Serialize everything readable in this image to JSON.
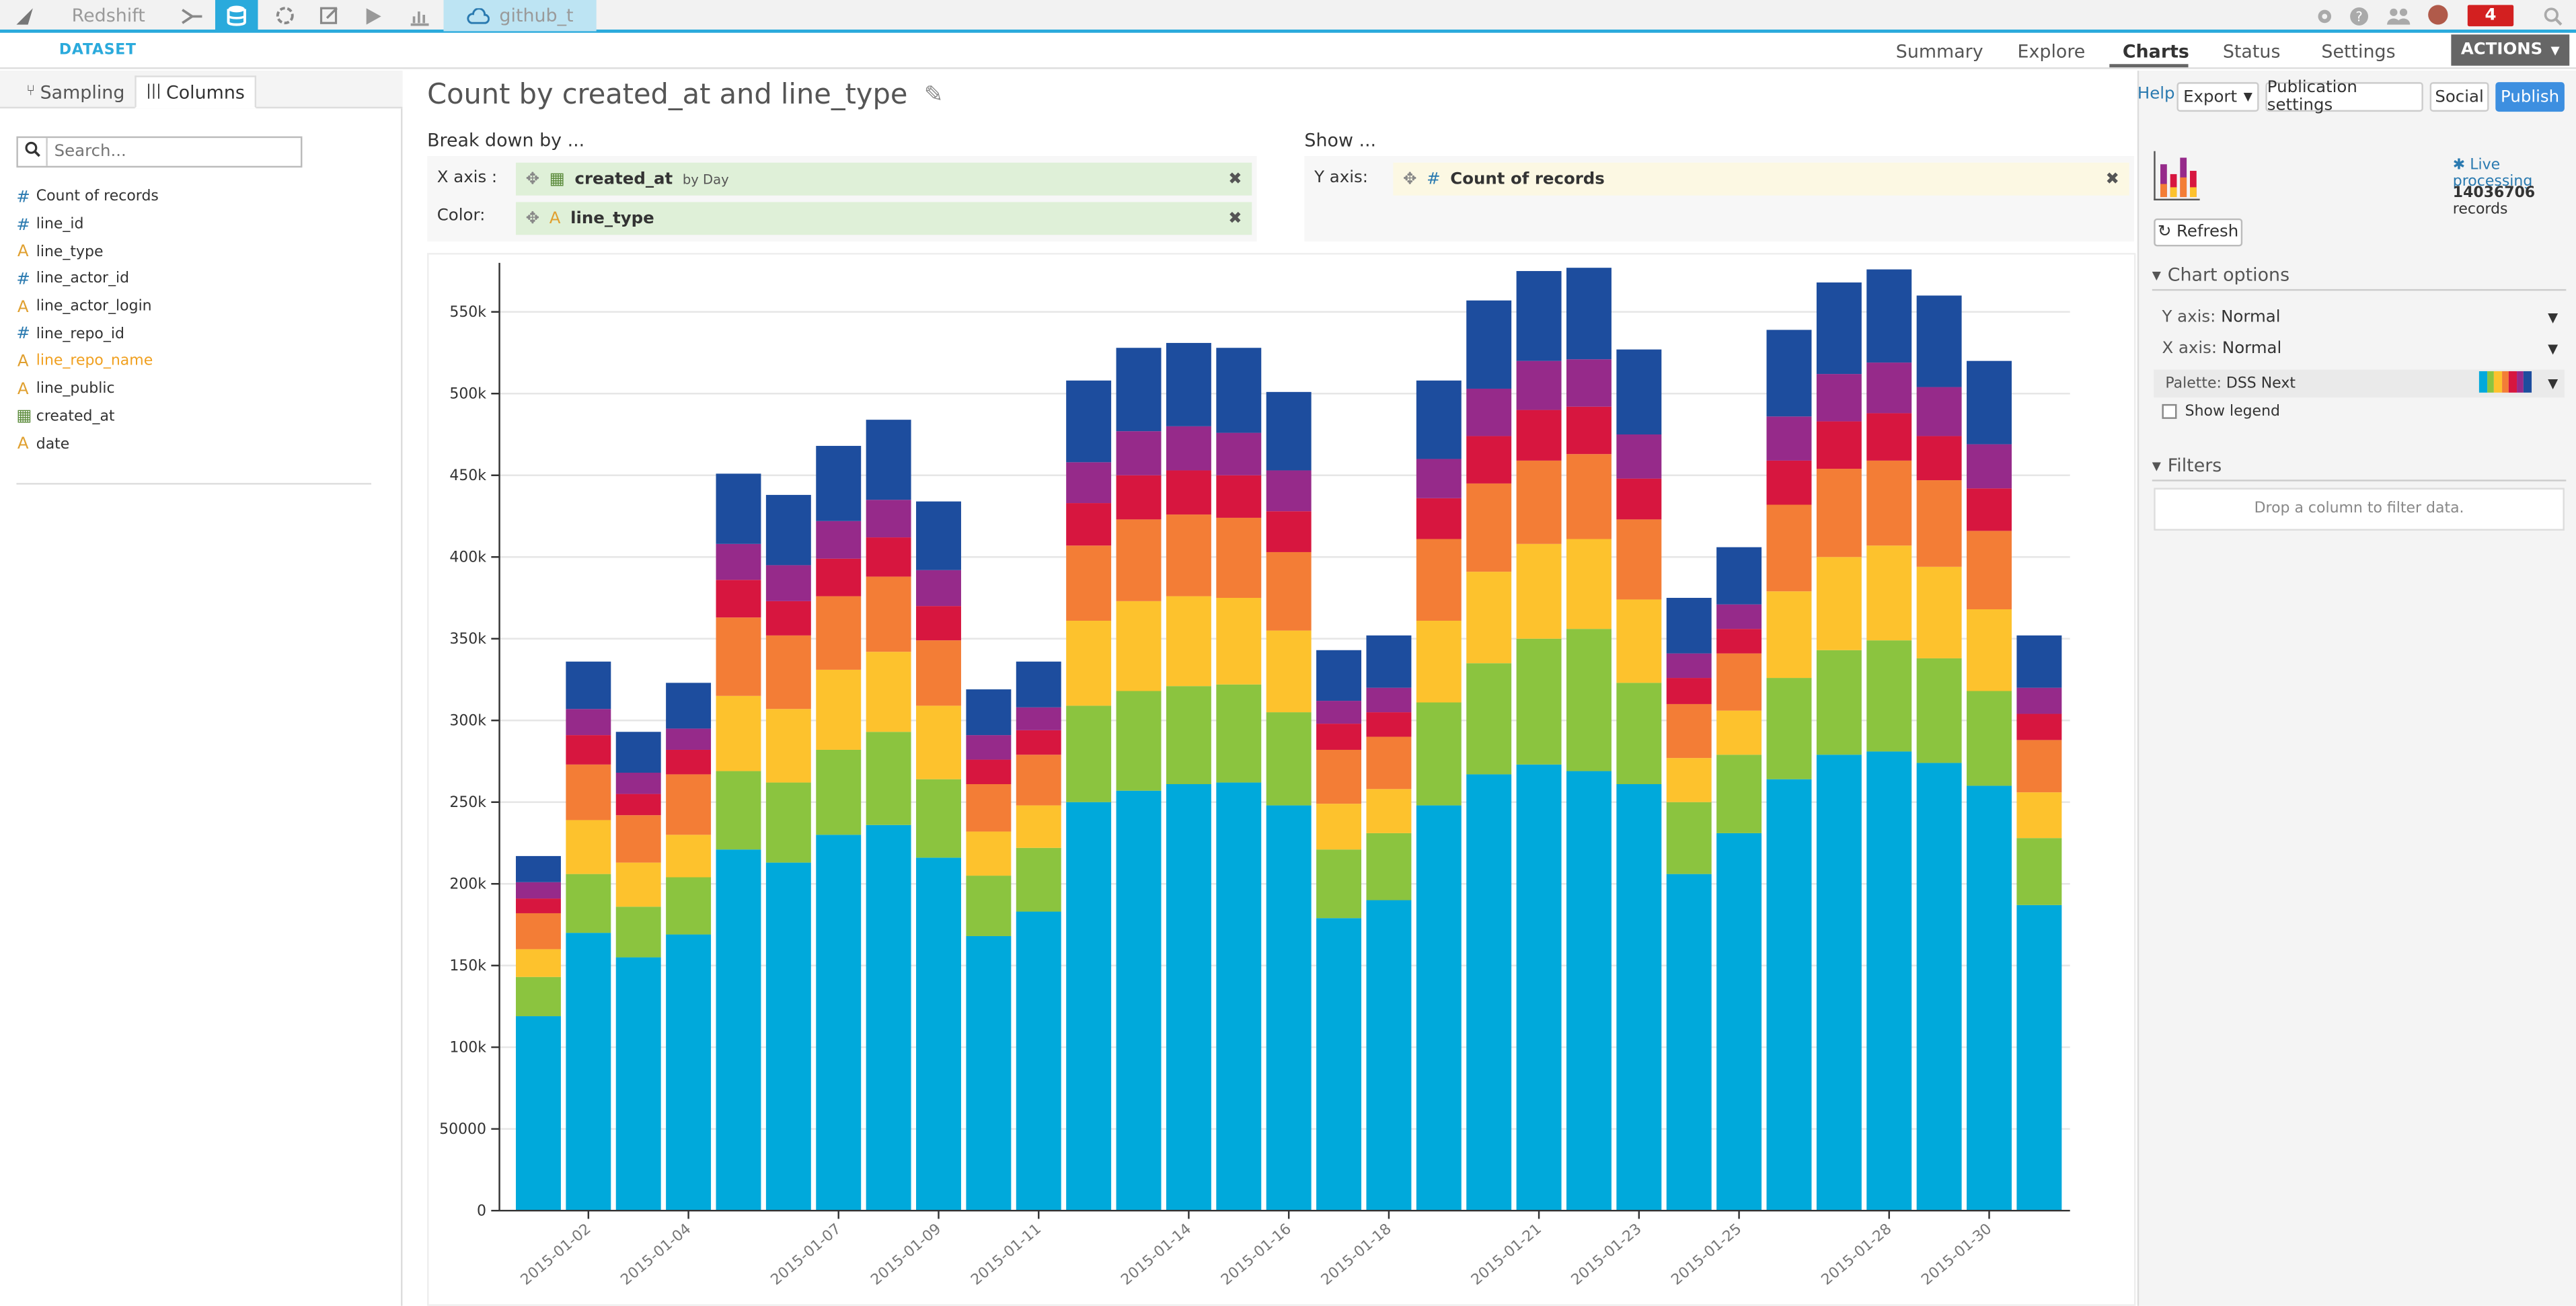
{
  "topbar": {
    "project": "Redshift",
    "dataset_tab": "github_t",
    "notif_count": "4"
  },
  "subbar": {
    "dataset_label": "DATASET",
    "tabs": [
      "Summary",
      "Explore",
      "Charts",
      "Status",
      "Settings"
    ],
    "active_tab": "Charts",
    "actions": "ACTIONS"
  },
  "left": {
    "tabs": [
      "Sampling",
      "Columns"
    ],
    "active_tab": "Columns",
    "search_placeholder": "Search...",
    "columns": [
      {
        "name": "Count of records",
        "type": "#"
      },
      {
        "name": "line_id",
        "type": "#"
      },
      {
        "name": "line_type",
        "type": "A"
      },
      {
        "name": "line_actor_id",
        "type": "#"
      },
      {
        "name": "line_actor_login",
        "type": "A"
      },
      {
        "name": "line_repo_id",
        "type": "#"
      },
      {
        "name": "line_repo_name",
        "type": "A"
      },
      {
        "name": "line_public",
        "type": "A"
      },
      {
        "name": "created_at",
        "type": "date"
      },
      {
        "name": "date",
        "type": "A"
      }
    ]
  },
  "main": {
    "title": "Count by created_at and line_type",
    "breakdown_label": "Break down by ...",
    "show_label": "Show ...",
    "x_axis_label": "X axis :",
    "color_label": "Color:",
    "y_axis_label": "Y axis:",
    "x_pill": "created_at",
    "x_pill_sub": "by Day",
    "color_pill": "line_type",
    "y_pill": "Count of records"
  },
  "right": {
    "help": "Help",
    "export": "Export",
    "publication_settings": "Publication settings",
    "social": "Social",
    "publish": "Publish",
    "live_processing": "Live processing",
    "records_count": "14036706",
    "records_word": "records",
    "refresh": "Refresh",
    "chart_options": "Chart options",
    "y_axis_opt_label": "Y axis:",
    "y_axis_opt_value": "Normal",
    "x_axis_opt_label": "X axis:",
    "x_axis_opt_value": "Normal",
    "palette_label": "Palette:",
    "palette_value": "DSS Next",
    "show_legend": "Show legend",
    "filters": "Filters",
    "drop_hint": "Drop a column to filter data."
  },
  "colors": {
    "accent": "#2aaadc",
    "series": [
      "#00a9db",
      "#8bc43f",
      "#fdc22d",
      "#f37d36",
      "#d7163f",
      "#962a8a",
      "#1d4d9e"
    ]
  },
  "chart_data": {
    "type": "bar",
    "stacked": true,
    "ylim": [
      0,
      575000
    ],
    "yticks": [
      0,
      50000,
      100000,
      150000,
      200000,
      250000,
      300000,
      350000,
      400000,
      450000,
      500000,
      550000
    ],
    "ytick_labels": [
      "0",
      "50000",
      "100k",
      "150k",
      "200k",
      "250k",
      "300k",
      "350k",
      "400k",
      "450k",
      "500k",
      "550k"
    ],
    "categories": [
      "2015-01-01",
      "2015-01-02",
      "2015-01-03",
      "2015-01-04",
      "2015-01-05",
      "2015-01-06",
      "2015-01-07",
      "2015-01-08",
      "2015-01-09",
      "2015-01-10",
      "2015-01-11",
      "2015-01-12",
      "2015-01-13",
      "2015-01-14",
      "2015-01-15",
      "2015-01-16",
      "2015-01-17",
      "2015-01-18",
      "2015-01-19",
      "2015-01-20",
      "2015-01-21",
      "2015-01-22",
      "2015-01-23",
      "2015-01-24",
      "2015-01-25",
      "2015-01-26",
      "2015-01-27",
      "2015-01-28",
      "2015-01-29",
      "2015-01-30"
    ],
    "x_tick_labels": [
      "2015-01-02",
      "2015-01-04",
      "2015-01-07",
      "2015-01-09",
      "2015-01-11",
      "2015-01-14",
      "2015-01-16",
      "2015-01-18",
      "2015-01-21",
      "2015-01-23",
      "2015-01-25",
      "2015-01-28",
      "2015-01-30"
    ],
    "series": [
      {
        "values": [
          119000,
          170000,
          155000,
          169000,
          221000,
          213000,
          230000,
          236000,
          216000,
          168000,
          183000,
          250000,
          257000,
          261000,
          262000,
          248000,
          179000,
          190000,
          248000,
          267000,
          273000,
          269000,
          261000,
          206000,
          231000,
          264000,
          279000,
          281000,
          274000,
          260000,
          187000
        ]
      },
      {
        "values": [
          24000,
          36000,
          31000,
          35000,
          48000,
          49000,
          52000,
          57000,
          48000,
          37000,
          39000,
          59000,
          61000,
          60000,
          60000,
          57000,
          42000,
          41000,
          63000,
          68000,
          77000,
          87000,
          62000,
          44000,
          48000,
          62000,
          64000,
          68000,
          64000,
          58000,
          41000
        ]
      },
      {
        "values": [
          17000,
          33000,
          27000,
          26000,
          46000,
          45000,
          49000,
          49000,
          45000,
          27000,
          26000,
          52000,
          55000,
          55000,
          53000,
          50000,
          28000,
          27000,
          50000,
          56000,
          58000,
          55000,
          51000,
          27000,
          27000,
          53000,
          57000,
          58000,
          56000,
          50000,
          28000
        ]
      },
      {
        "values": [
          22000,
          34000,
          29000,
          37000,
          48000,
          45000,
          45000,
          46000,
          40000,
          29000,
          31000,
          46000,
          50000,
          50000,
          49000,
          48000,
          33000,
          32000,
          50000,
          54000,
          51000,
          52000,
          49000,
          33000,
          35000,
          53000,
          54000,
          52000,
          53000,
          48000,
          32000
        ]
      },
      {
        "values": [
          9000,
          18000,
          13000,
          15000,
          23000,
          21000,
          23000,
          24000,
          21000,
          15000,
          15000,
          26000,
          27000,
          27000,
          26000,
          25000,
          16000,
          15000,
          25000,
          29000,
          31000,
          29000,
          25000,
          16000,
          15000,
          27000,
          29000,
          29000,
          27000,
          26000,
          16000
        ]
      },
      {
        "values": [
          10000,
          16000,
          13000,
          13000,
          22000,
          22000,
          23000,
          23000,
          22000,
          15000,
          14000,
          25000,
          27000,
          27000,
          26000,
          25000,
          14000,
          15000,
          24000,
          29000,
          30000,
          29000,
          27000,
          15000,
          15000,
          27000,
          29000,
          31000,
          30000,
          27000,
          16000
        ]
      },
      {
        "values": [
          16000,
          29000,
          25000,
          28000,
          43000,
          43000,
          46000,
          49000,
          42000,
          28000,
          28000,
          50000,
          51000,
          51000,
          52000,
          48000,
          31000,
          32000,
          48000,
          54000,
          55000,
          56000,
          52000,
          34000,
          35000,
          53000,
          56000,
          57000,
          56000,
          51000,
          32000
        ]
      }
    ]
  }
}
